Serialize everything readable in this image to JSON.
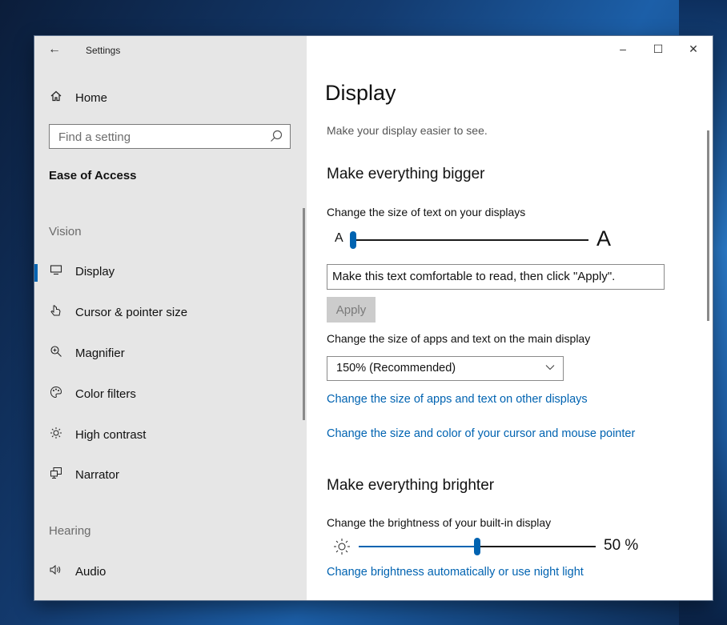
{
  "window": {
    "title": "Settings",
    "controls": {
      "minimize": "–",
      "maximize": "☐",
      "close": "✕"
    }
  },
  "sidebar": {
    "home_label": "Home",
    "search_placeholder": "Find a setting",
    "section_title": "Ease of Access",
    "groups": {
      "vision": "Vision",
      "hearing": "Hearing"
    },
    "items": [
      {
        "label": "Display",
        "icon": "monitor-icon",
        "active": true
      },
      {
        "label": "Cursor & pointer size",
        "icon": "pointer-icon"
      },
      {
        "label": "Magnifier",
        "icon": "magnifier-icon"
      },
      {
        "label": "Color filters",
        "icon": "palette-icon"
      },
      {
        "label": "High contrast",
        "icon": "contrast-icon"
      },
      {
        "label": "Narrator",
        "icon": "narrator-icon"
      },
      {
        "label": "Audio",
        "icon": "speaker-icon"
      }
    ]
  },
  "main": {
    "title": "Display",
    "subtitle": "Make your display easier to see.",
    "bigger": {
      "heading": "Make everything bigger",
      "text_size_label": "Change the size of text on your displays",
      "small_a": "A",
      "large_a": "A",
      "text_size_level": 0.0,
      "sample_text": "Make this text comfortable to read, then click \"Apply\".",
      "apply_label": "Apply",
      "scale_label": "Change the size of apps and text on the main display",
      "scale_value": "150% (Recommended)",
      "link_other_displays": "Change the size of apps and text on other displays",
      "link_cursor": "Change the size and color of your cursor and mouse pointer"
    },
    "brighter": {
      "heading": "Make everything brighter",
      "brightness_label": "Change the brightness of your built-in display",
      "brightness_value": 50,
      "brightness_text": "50 %",
      "link_night_light": "Change brightness automatically or use night light"
    }
  },
  "colors": {
    "accent": "#0063b1",
    "sidebar_bg": "#e6e6e6"
  }
}
